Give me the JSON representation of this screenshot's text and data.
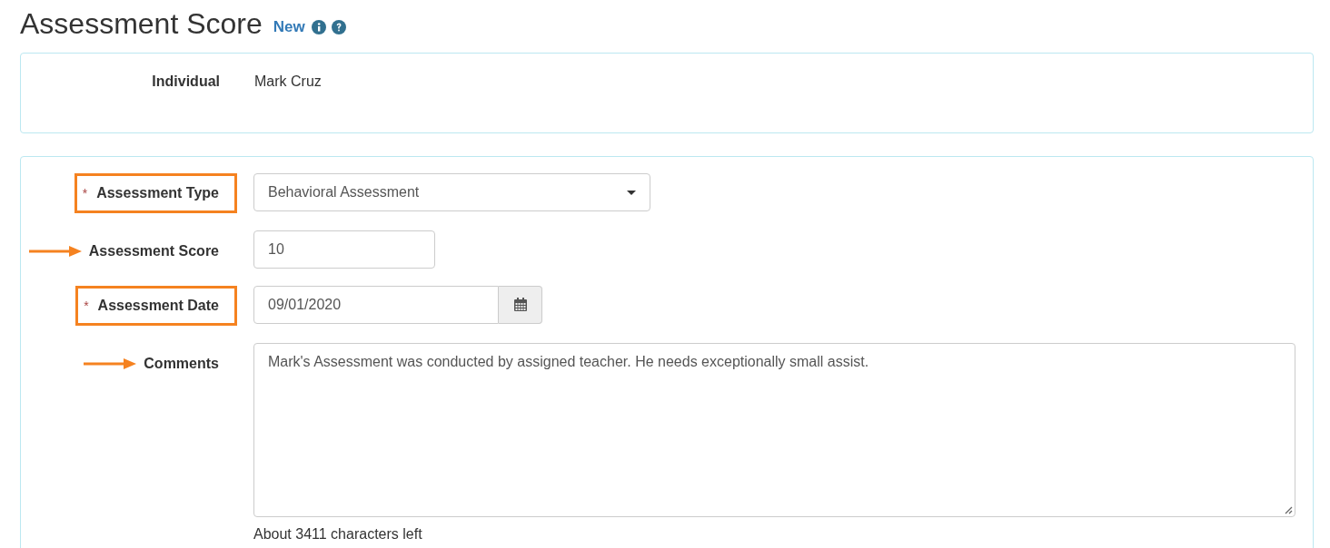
{
  "header": {
    "title": "Assessment Score",
    "badge": "New"
  },
  "individual": {
    "label": "Individual",
    "value": "Mark Cruz"
  },
  "fields": [
    {
      "kind": "select",
      "required_mark": "*",
      "label": "Assessment Type",
      "boxed": true,
      "arrow": false,
      "value": "Behavioral Assessment"
    },
    {
      "kind": "text",
      "label": "Assessment Score",
      "boxed": false,
      "arrow": true,
      "value": "10"
    },
    {
      "kind": "date",
      "required_mark": "*",
      "label": "Assessment Date",
      "boxed": true,
      "arrow": false,
      "value": "09/01/2020"
    },
    {
      "kind": "textarea",
      "label": "Comments",
      "boxed": false,
      "arrow": true,
      "value": "Mark's Assessment was conducted by assigned teacher. He needs exceptionally small assist.",
      "help": "About 3411 characters left"
    }
  ]
}
